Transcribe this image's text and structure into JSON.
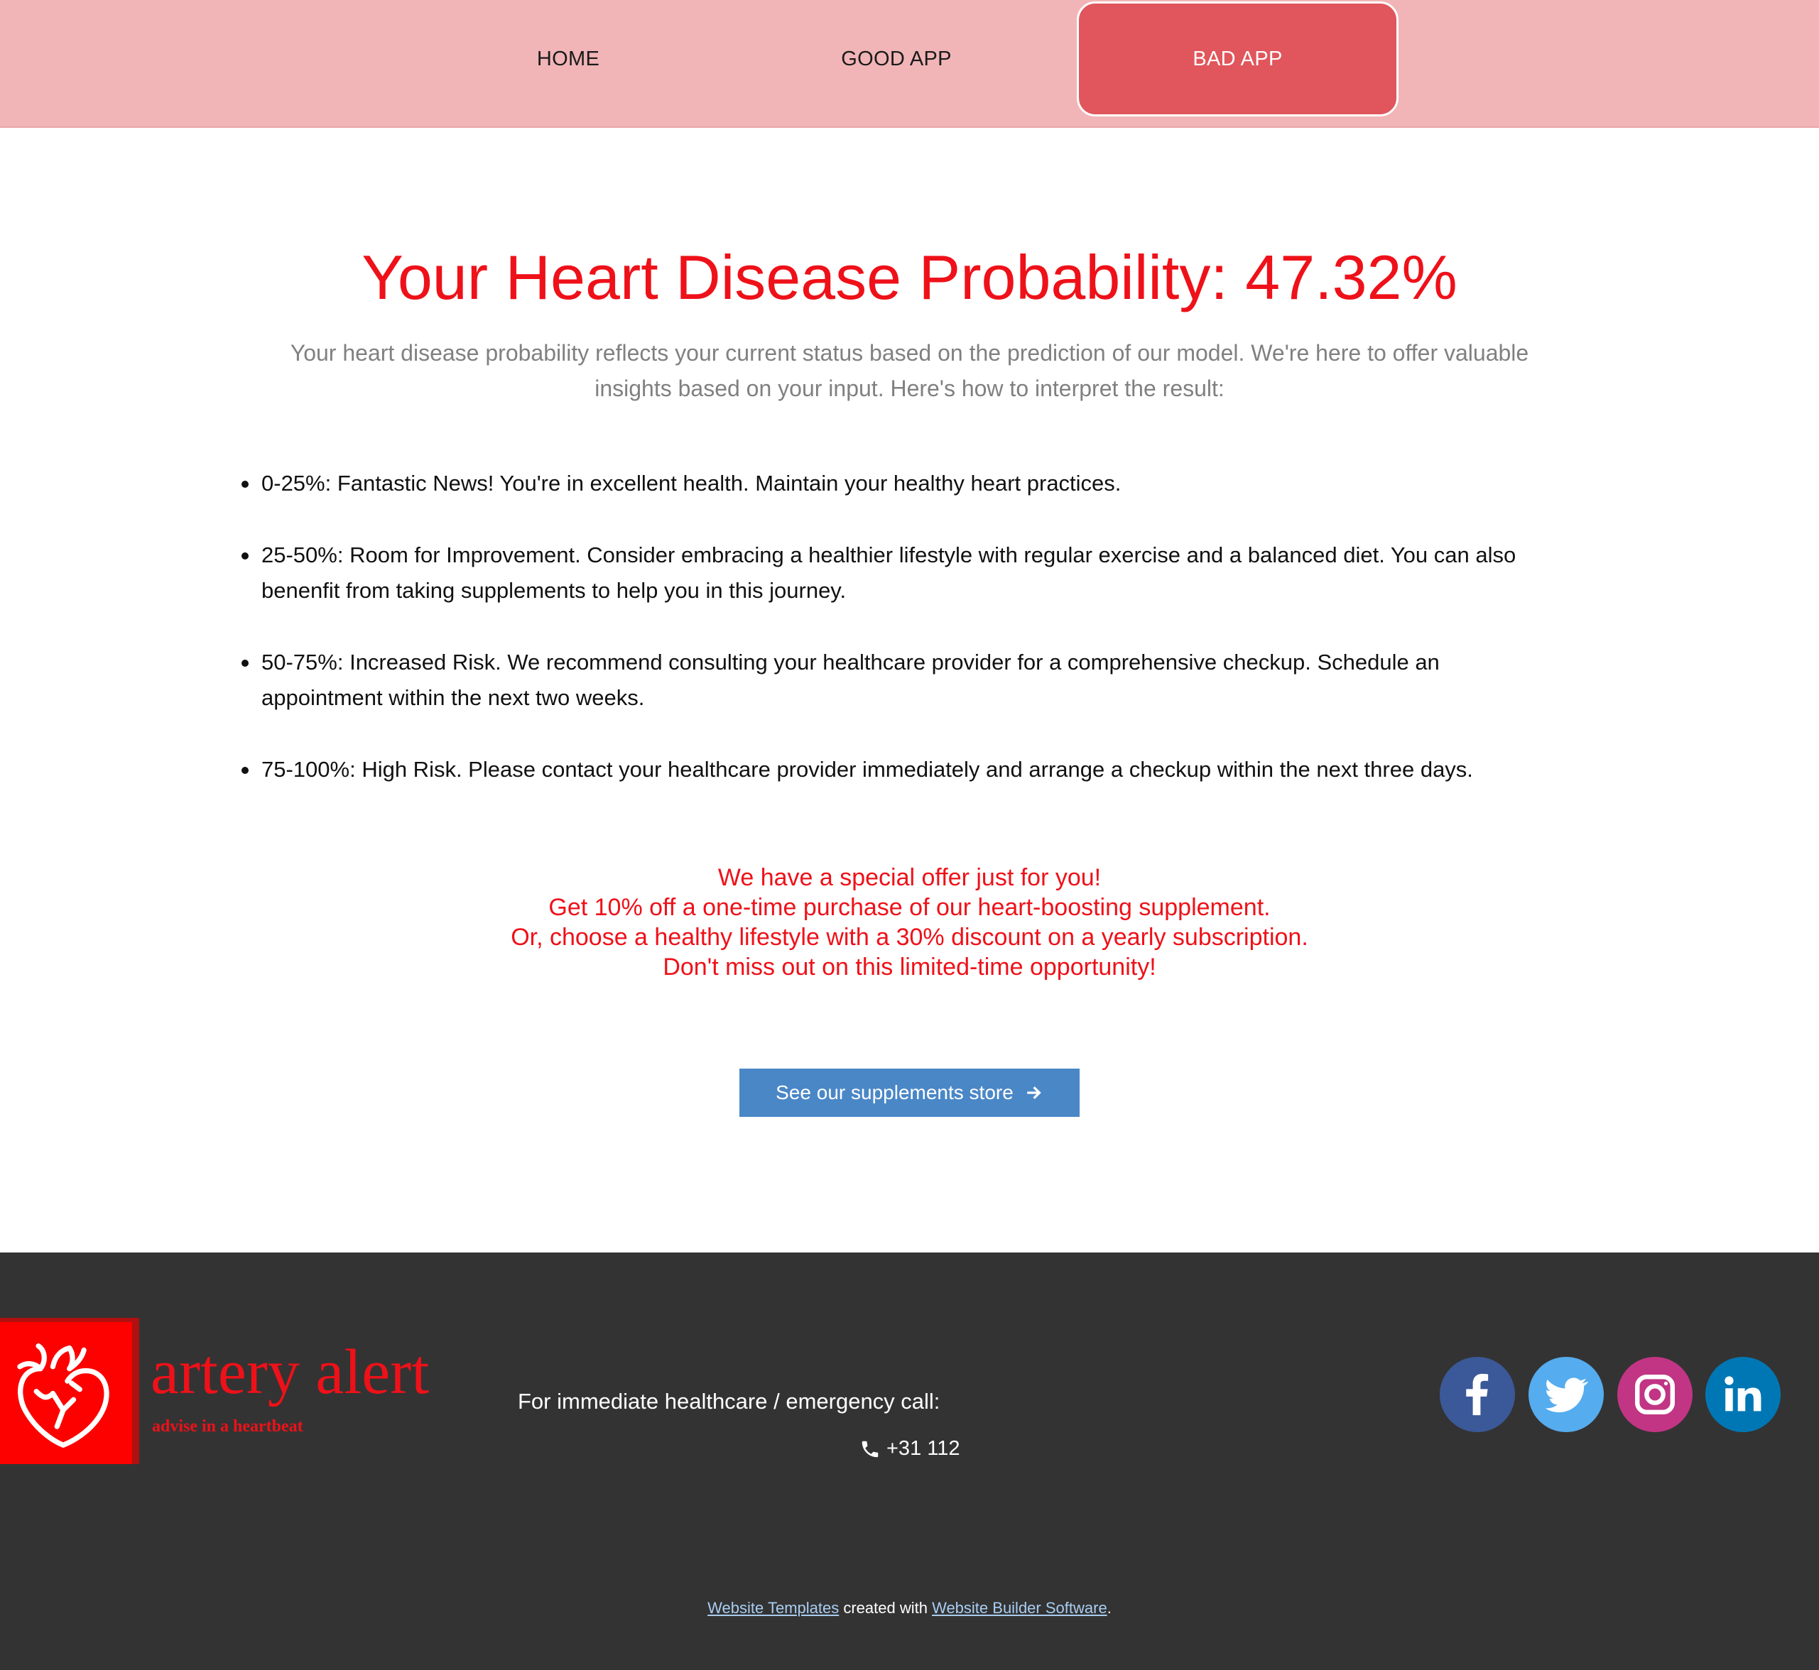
{
  "nav": {
    "items": [
      {
        "label": "HOME"
      },
      {
        "label": "GOOD APP"
      },
      {
        "label": "BAD APP",
        "active": true
      }
    ],
    "background": "#f1b5b7",
    "active_color": "#e0565c"
  },
  "main": {
    "title": "Your Heart Disease Probability: 47.32%",
    "probability_percent": 47.32,
    "intro": "Your heart disease probability reflects your current status based on the prediction of our model. We're here to offer valuable insights based on your input. Here's how to interpret the result:",
    "ranges": [
      {
        "text": "0-25%: Fantastic News! You're in excellent health. Maintain your healthy heart practices."
      },
      {
        "text": "25-50%: Room for Improvement. Consider embracing a healthier lifestyle with regular exercise and a balanced diet. You can also benenfit from taking supplements to help you in this journey."
      },
      {
        "text": "50-75%: Increased Risk. We recommend consulting your healthcare provider for a comprehensive checkup. Schedule an appointment within the next two weeks."
      },
      {
        "text": "75-100%: High Risk. Please contact your healthcare provider immediately and arrange a checkup within the next three days."
      }
    ],
    "offer": {
      "lines": [
        "We have a special offer just for you!",
        "Get 10% off a one-time purchase of our heart-boosting supplement.",
        "Or, choose a healthy lifestyle with a 30% discount on a yearly subscription.",
        "Don't miss out on this limited-time opportunity!"
      ],
      "color": "#ee1119"
    },
    "store_button": {
      "label": "See our supplements store",
      "icon": "arrow-right-icon",
      "color": "#4a87c7"
    }
  },
  "footer": {
    "brand": {
      "name": "artery alert",
      "tagline": "advise in a heartbeat",
      "icon": "heart-organ-icon",
      "color": "#fd0000"
    },
    "emergency_label": "For immediate healthcare / emergency call:",
    "phone": {
      "icon": "phone-icon",
      "number": "+31 112"
    },
    "social": [
      {
        "name": "facebook",
        "icon": "facebook-icon",
        "color": "#3b5998"
      },
      {
        "name": "twitter",
        "icon": "twitter-icon",
        "color": "#55acee"
      },
      {
        "name": "instagram",
        "icon": "instagram-icon",
        "color": "#c13584"
      },
      {
        "name": "linkedin",
        "icon": "linkedin-icon",
        "color": "#0077b5"
      }
    ],
    "credits": {
      "link1": "Website Templates",
      "middle": " created with ",
      "link2": "Website Builder Software",
      "end": "."
    },
    "background": "#333333"
  }
}
